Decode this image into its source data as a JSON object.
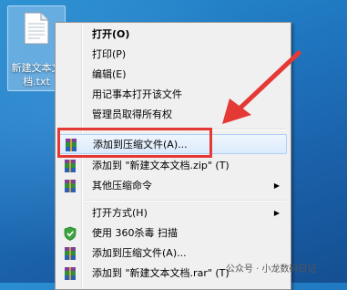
{
  "desktop": {
    "file": {
      "label": "新建文本文\n档.txt"
    }
  },
  "context_menu": {
    "items": [
      {
        "label": "打开(O)",
        "bold": true
      },
      {
        "label": "打印(P)"
      },
      {
        "label": "编辑(E)"
      },
      {
        "label": "用记事本打开该文件"
      },
      {
        "label": "管理员取得所有权"
      },
      {
        "label": "添加到压缩文件(A)...",
        "icon": "winrar-icon"
      },
      {
        "label": "添加到 \"新建文本文档.zip\" (T)",
        "icon": "winrar-icon"
      },
      {
        "label": "其他压缩命令",
        "icon": "winrar-icon",
        "submenu": true
      },
      {
        "label": "打开方式(H)",
        "submenu": true
      },
      {
        "label": "使用 360杀毒 扫描",
        "icon": "360-shield-icon"
      },
      {
        "label": "添加到压缩文件(A)...",
        "icon": "winrar-icon"
      },
      {
        "label": "添加到 \"新建文本文档.rar\" (T)",
        "icon": "winrar-icon"
      }
    ]
  },
  "annotation": {
    "color": "#e53935"
  },
  "watermark": {
    "text": "公众号 · 小龙数码日记"
  }
}
